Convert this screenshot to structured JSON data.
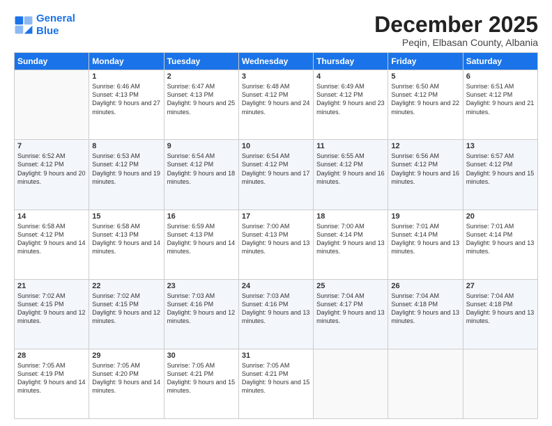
{
  "header": {
    "logo_line1": "General",
    "logo_line2": "Blue",
    "title": "December 2025",
    "subtitle": "Peqin, Elbasan County, Albania"
  },
  "days_of_week": [
    "Sunday",
    "Monday",
    "Tuesday",
    "Wednesday",
    "Thursday",
    "Friday",
    "Saturday"
  ],
  "weeks": [
    [
      {
        "day": "",
        "sunrise": "",
        "sunset": "",
        "daylight": ""
      },
      {
        "day": "1",
        "sunrise": "Sunrise: 6:46 AM",
        "sunset": "Sunset: 4:13 PM",
        "daylight": "Daylight: 9 hours and 27 minutes."
      },
      {
        "day": "2",
        "sunrise": "Sunrise: 6:47 AM",
        "sunset": "Sunset: 4:13 PM",
        "daylight": "Daylight: 9 hours and 25 minutes."
      },
      {
        "day": "3",
        "sunrise": "Sunrise: 6:48 AM",
        "sunset": "Sunset: 4:12 PM",
        "daylight": "Daylight: 9 hours and 24 minutes."
      },
      {
        "day": "4",
        "sunrise": "Sunrise: 6:49 AM",
        "sunset": "Sunset: 4:12 PM",
        "daylight": "Daylight: 9 hours and 23 minutes."
      },
      {
        "day": "5",
        "sunrise": "Sunrise: 6:50 AM",
        "sunset": "Sunset: 4:12 PM",
        "daylight": "Daylight: 9 hours and 22 minutes."
      },
      {
        "day": "6",
        "sunrise": "Sunrise: 6:51 AM",
        "sunset": "Sunset: 4:12 PM",
        "daylight": "Daylight: 9 hours and 21 minutes."
      }
    ],
    [
      {
        "day": "7",
        "sunrise": "Sunrise: 6:52 AM",
        "sunset": "Sunset: 4:12 PM",
        "daylight": "Daylight: 9 hours and 20 minutes."
      },
      {
        "day": "8",
        "sunrise": "Sunrise: 6:53 AM",
        "sunset": "Sunset: 4:12 PM",
        "daylight": "Daylight: 9 hours and 19 minutes."
      },
      {
        "day": "9",
        "sunrise": "Sunrise: 6:54 AM",
        "sunset": "Sunset: 4:12 PM",
        "daylight": "Daylight: 9 hours and 18 minutes."
      },
      {
        "day": "10",
        "sunrise": "Sunrise: 6:54 AM",
        "sunset": "Sunset: 4:12 PM",
        "daylight": "Daylight: 9 hours and 17 minutes."
      },
      {
        "day": "11",
        "sunrise": "Sunrise: 6:55 AM",
        "sunset": "Sunset: 4:12 PM",
        "daylight": "Daylight: 9 hours and 16 minutes."
      },
      {
        "day": "12",
        "sunrise": "Sunrise: 6:56 AM",
        "sunset": "Sunset: 4:12 PM",
        "daylight": "Daylight: 9 hours and 16 minutes."
      },
      {
        "day": "13",
        "sunrise": "Sunrise: 6:57 AM",
        "sunset": "Sunset: 4:12 PM",
        "daylight": "Daylight: 9 hours and 15 minutes."
      }
    ],
    [
      {
        "day": "14",
        "sunrise": "Sunrise: 6:58 AM",
        "sunset": "Sunset: 4:12 PM",
        "daylight": "Daylight: 9 hours and 14 minutes."
      },
      {
        "day": "15",
        "sunrise": "Sunrise: 6:58 AM",
        "sunset": "Sunset: 4:13 PM",
        "daylight": "Daylight: 9 hours and 14 minutes."
      },
      {
        "day": "16",
        "sunrise": "Sunrise: 6:59 AM",
        "sunset": "Sunset: 4:13 PM",
        "daylight": "Daylight: 9 hours and 14 minutes."
      },
      {
        "day": "17",
        "sunrise": "Sunrise: 7:00 AM",
        "sunset": "Sunset: 4:13 PM",
        "daylight": "Daylight: 9 hours and 13 minutes."
      },
      {
        "day": "18",
        "sunrise": "Sunrise: 7:00 AM",
        "sunset": "Sunset: 4:14 PM",
        "daylight": "Daylight: 9 hours and 13 minutes."
      },
      {
        "day": "19",
        "sunrise": "Sunrise: 7:01 AM",
        "sunset": "Sunset: 4:14 PM",
        "daylight": "Daylight: 9 hours and 13 minutes."
      },
      {
        "day": "20",
        "sunrise": "Sunrise: 7:01 AM",
        "sunset": "Sunset: 4:14 PM",
        "daylight": "Daylight: 9 hours and 13 minutes."
      }
    ],
    [
      {
        "day": "21",
        "sunrise": "Sunrise: 7:02 AM",
        "sunset": "Sunset: 4:15 PM",
        "daylight": "Daylight: 9 hours and 12 minutes."
      },
      {
        "day": "22",
        "sunrise": "Sunrise: 7:02 AM",
        "sunset": "Sunset: 4:15 PM",
        "daylight": "Daylight: 9 hours and 12 minutes."
      },
      {
        "day": "23",
        "sunrise": "Sunrise: 7:03 AM",
        "sunset": "Sunset: 4:16 PM",
        "daylight": "Daylight: 9 hours and 12 minutes."
      },
      {
        "day": "24",
        "sunrise": "Sunrise: 7:03 AM",
        "sunset": "Sunset: 4:16 PM",
        "daylight": "Daylight: 9 hours and 13 minutes."
      },
      {
        "day": "25",
        "sunrise": "Sunrise: 7:04 AM",
        "sunset": "Sunset: 4:17 PM",
        "daylight": "Daylight: 9 hours and 13 minutes."
      },
      {
        "day": "26",
        "sunrise": "Sunrise: 7:04 AM",
        "sunset": "Sunset: 4:18 PM",
        "daylight": "Daylight: 9 hours and 13 minutes."
      },
      {
        "day": "27",
        "sunrise": "Sunrise: 7:04 AM",
        "sunset": "Sunset: 4:18 PM",
        "daylight": "Daylight: 9 hours and 13 minutes."
      }
    ],
    [
      {
        "day": "28",
        "sunrise": "Sunrise: 7:05 AM",
        "sunset": "Sunset: 4:19 PM",
        "daylight": "Daylight: 9 hours and 14 minutes."
      },
      {
        "day": "29",
        "sunrise": "Sunrise: 7:05 AM",
        "sunset": "Sunset: 4:20 PM",
        "daylight": "Daylight: 9 hours and 14 minutes."
      },
      {
        "day": "30",
        "sunrise": "Sunrise: 7:05 AM",
        "sunset": "Sunset: 4:21 PM",
        "daylight": "Daylight: 9 hours and 15 minutes."
      },
      {
        "day": "31",
        "sunrise": "Sunrise: 7:05 AM",
        "sunset": "Sunset: 4:21 PM",
        "daylight": "Daylight: 9 hours and 15 minutes."
      },
      {
        "day": "",
        "sunrise": "",
        "sunset": "",
        "daylight": ""
      },
      {
        "day": "",
        "sunrise": "",
        "sunset": "",
        "daylight": ""
      },
      {
        "day": "",
        "sunrise": "",
        "sunset": "",
        "daylight": ""
      }
    ]
  ]
}
